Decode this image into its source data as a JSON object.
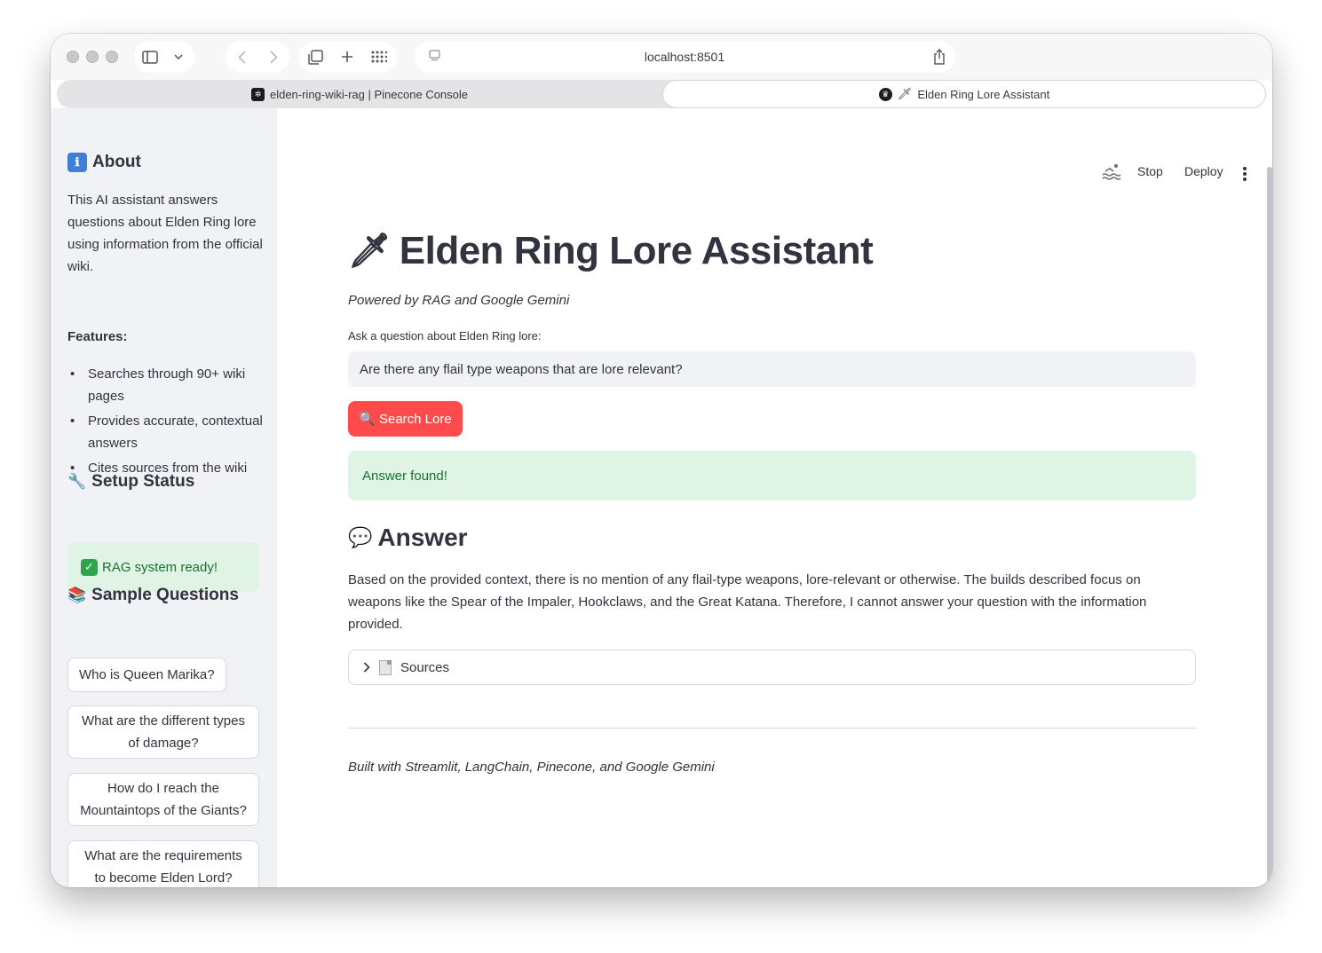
{
  "browser": {
    "url": "localhost:8501",
    "tabs": [
      {
        "label": "elden-ring-wiki-rag | Pinecone Console",
        "active": false
      },
      {
        "label": "Elden Ring Lore Assistant",
        "active": true,
        "emoji": "🗡"
      }
    ]
  },
  "sidebar": {
    "about": {
      "heading": "About",
      "icon": "ℹ",
      "description": "This AI assistant answers questions about Elden Ring lore using information from the official wiki.",
      "features_label": "Features:",
      "features": [
        "Searches through 90+ wiki pages",
        "Provides accurate, contextual answers",
        "Cites sources from the wiki"
      ]
    },
    "setup": {
      "heading": "Setup Status",
      "icon": "🔧",
      "status": "RAG system ready!"
    },
    "samples": {
      "heading": "Sample Questions",
      "icon": "📚",
      "questions": [
        "Who is Queen Marika?",
        "What are the different types of damage?",
        "How do I reach the Mountaintops of the Giants?",
        "What are the requirements to become Elden Lord?"
      ]
    }
  },
  "header": {
    "stop_label": "Stop",
    "deploy_label": "Deploy"
  },
  "main": {
    "title": "Elden Ring Lore Assistant",
    "title_emoji": "🗡",
    "caption": "Powered by RAG and Google Gemini",
    "input_label": "Ask a question about Elden Ring lore:",
    "input_value": "Are there any flail type weapons that are lore relevant?",
    "search_button": "Search Lore",
    "search_icon": "🔍",
    "alert": "Answer found!",
    "answer_heading": "Answer",
    "answer_icon": "💬",
    "answer_text": "Based on the provided context, there is no mention of any flail-type weapons, lore-relevant or otherwise. The builds described focus on weapons like the Spear of the Impaler, Hookclaws, and the Great Katana. Therefore, I cannot answer your question with the information provided.",
    "sources_label": "Sources",
    "footer": "Built with Streamlit, LangChain, Pinecone, and Google Gemini"
  },
  "colors": {
    "primary": "#ff4b4b",
    "sidebar_bg": "#f0f2f6",
    "success_bg": "#dff4e5",
    "success_text": "#177233",
    "text": "#31333f"
  }
}
